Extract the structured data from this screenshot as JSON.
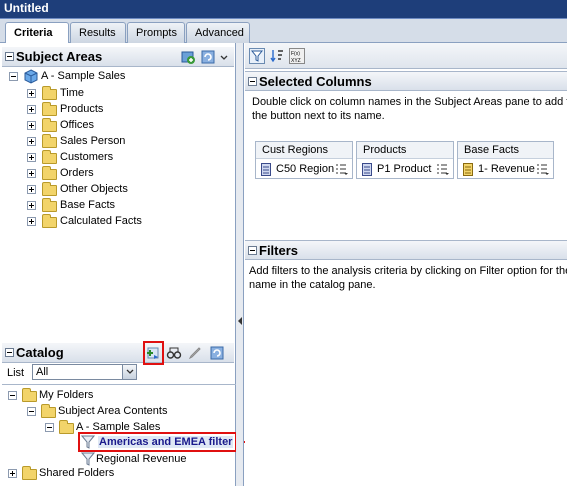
{
  "window": {
    "title": "Untitled"
  },
  "tabs": [
    {
      "label": "Criteria",
      "active": true
    },
    {
      "label": "Results"
    },
    {
      "label": "Prompts"
    },
    {
      "label": "Advanced"
    }
  ],
  "subject_areas": {
    "title": "Subject Areas",
    "root": "A - Sample Sales",
    "items": [
      "Time",
      "Products",
      "Offices",
      "Sales Person",
      "Customers",
      "Orders",
      "Other Objects",
      "Base Facts",
      "Calculated Facts"
    ]
  },
  "catalog": {
    "title": "Catalog",
    "list_label": "List",
    "list_value": "All",
    "tree": {
      "my_folders": "My Folders",
      "subject_area_contents": "Subject Area Contents",
      "sample_sales": "A - Sample Sales",
      "filter_selected": "Americas and EMEA filter",
      "regional_revenue": "Regional Revenue",
      "shared_folders": "Shared Folders"
    }
  },
  "selected_columns": {
    "title": "Selected Columns",
    "hint": "Double click on column names in the Subject Areas pane to add th",
    "hint2": "the button next to its name.",
    "columns": [
      {
        "header": "Cust Regions",
        "value": "C50 Region"
      },
      {
        "header": "Products",
        "value": "P1 Product"
      },
      {
        "header": "Base Facts",
        "value": "1- Revenue"
      }
    ]
  },
  "filters": {
    "title": "Filters",
    "hint": "Add filters to the analysis criteria by clicking on Filter option for the",
    "hint2": "name in the catalog pane."
  },
  "colors": {
    "title_bar": "#1e3e7a",
    "highlight": "#e01010",
    "selected_text": "#1a1a8c"
  }
}
